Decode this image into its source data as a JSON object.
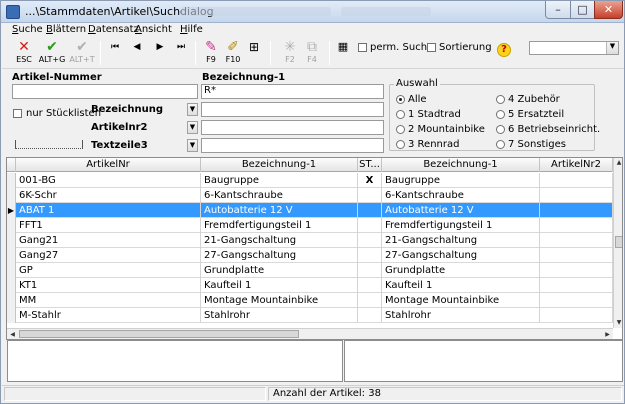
{
  "window": {
    "title": "...\\Stammdaten\\Artikel\\Suchdialog",
    "min": "–",
    "max": "□",
    "close": "✕"
  },
  "menu": [
    "Suche",
    "Blättern",
    "Datensatz",
    "Ansicht",
    "Hilfe"
  ],
  "toolbar": {
    "esc_label": "ESC",
    "altg_label": "ALT+G",
    "altt_label": "ALT+T",
    "f9_label": "F9",
    "f10_label": "F10",
    "f2_label": "F2",
    "f4_label": "F4",
    "perm_search_label": "perm. Suche",
    "sort_label": "Sortierung",
    "help_glyph": "?",
    "combo_value": ""
  },
  "search": {
    "artikelnummer_label": "Artikel-Nummer",
    "artikelnummer_value": "",
    "bezeichnung_label": "Bezeichnung-1",
    "bezeichnung_value": "R*",
    "stuecklisten_label": "nur Stücklisten",
    "dd1_label": "Bezeichnung",
    "dd1_value": "",
    "dd2_label": "Artikelnr2",
    "dd2_value": "",
    "dd3_label": "Textzeile3",
    "dd3_value": ""
  },
  "auswahl": {
    "title": "Auswahl",
    "options": [
      "Alle",
      "1 Stadtrad",
      "2 Mountainbike",
      "3 Rennrad",
      "4 Zubehör",
      "5 Ersatzteil",
      "6 Betriebseinricht.",
      "7 Sonstiges"
    ],
    "selected": "Alle"
  },
  "grid": {
    "headers": [
      "ArtikelNr",
      "Bezeichnung-1",
      "ST...",
      "Bezeichnung-1",
      "ArtikelNr2"
    ],
    "rows": [
      [
        "001-BG",
        "Baugruppe",
        "X",
        "Baugruppe",
        ""
      ],
      [
        "6K-Schr",
        "6-Kantschraube",
        "",
        "6-Kantschraube",
        ""
      ],
      [
        "ABAT 1",
        "Autobatterie 12 V",
        "",
        "Autobatterie 12 V",
        ""
      ],
      [
        "FFT1",
        "Fremdfertigungsteil 1",
        "",
        "Fremdfertigungsteil 1",
        ""
      ],
      [
        "Gang21",
        "21-Gangschaltung",
        "",
        "21-Gangschaltung",
        ""
      ],
      [
        "Gang27",
        "27-Gangschaltung",
        "",
        "27-Gangschaltung",
        ""
      ],
      [
        "GP",
        "Grundplatte",
        "",
        "Grundplatte",
        ""
      ],
      [
        "KT1",
        "Kaufteil 1",
        "",
        "Kaufteil 1",
        ""
      ],
      [
        "MM",
        "Montage Mountainbike",
        "",
        "Montage Mountainbike",
        ""
      ],
      [
        "M-Stahlr",
        "Stahlrohr",
        "",
        "Stahlrohr",
        ""
      ]
    ],
    "selected_row": 2,
    "row_indicator": "▶"
  },
  "status": {
    "count_text": "Anzahl der Artikel: 38"
  }
}
